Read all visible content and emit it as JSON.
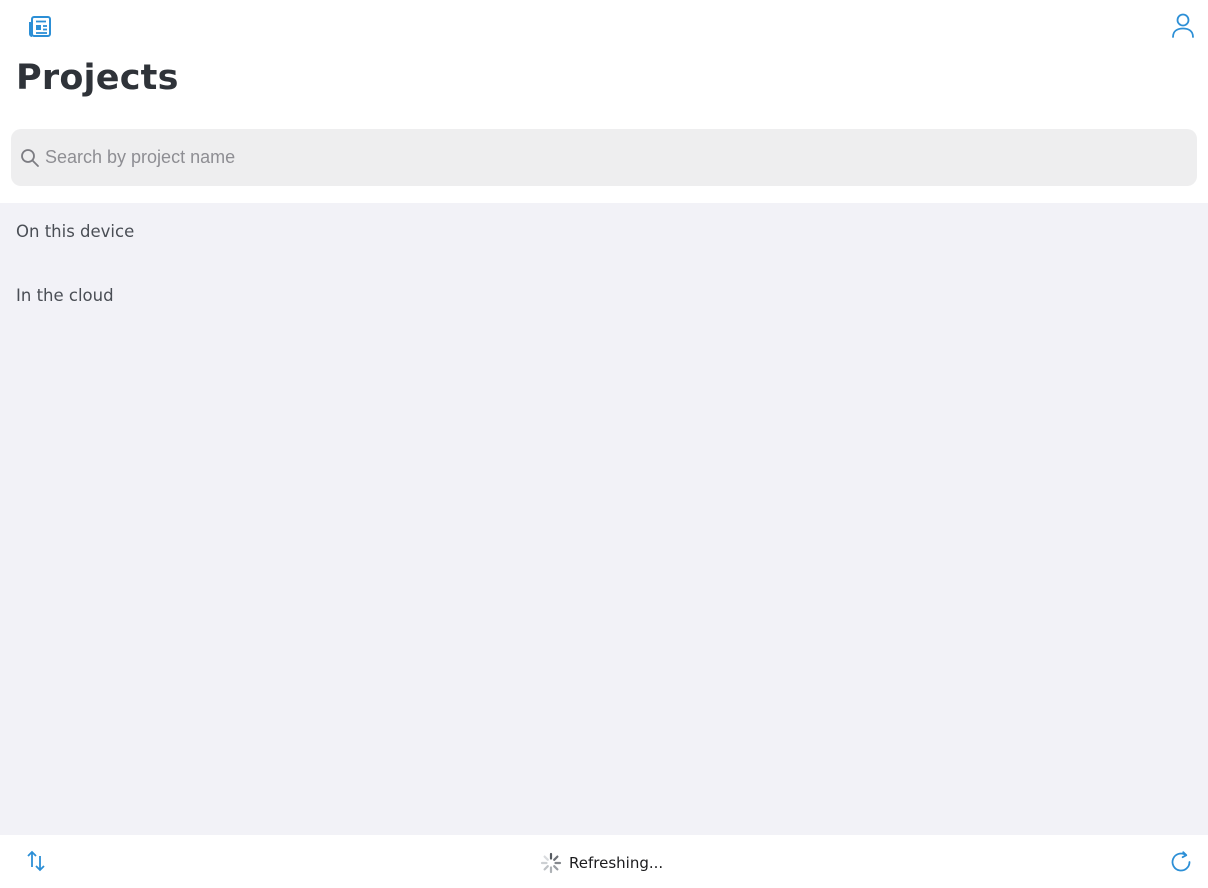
{
  "header": {
    "title": "Projects",
    "news_icon": "news-icon",
    "account_icon": "person-icon"
  },
  "search": {
    "placeholder": "Search by project name",
    "value": "",
    "icon": "search-icon"
  },
  "sections": {
    "device_label": "On this device",
    "cloud_label": "In the cloud"
  },
  "footer": {
    "status_text": "Refreshing...",
    "sort_icon": "sort-arrows-icon",
    "refresh_icon": "refresh-icon",
    "spinner_icon": "activity-spinner-icon"
  },
  "colors": {
    "accent": "#2c8fd6",
    "title": "#2f3339",
    "list_background": "#f2f2f7",
    "search_background": "#eeeeef"
  }
}
